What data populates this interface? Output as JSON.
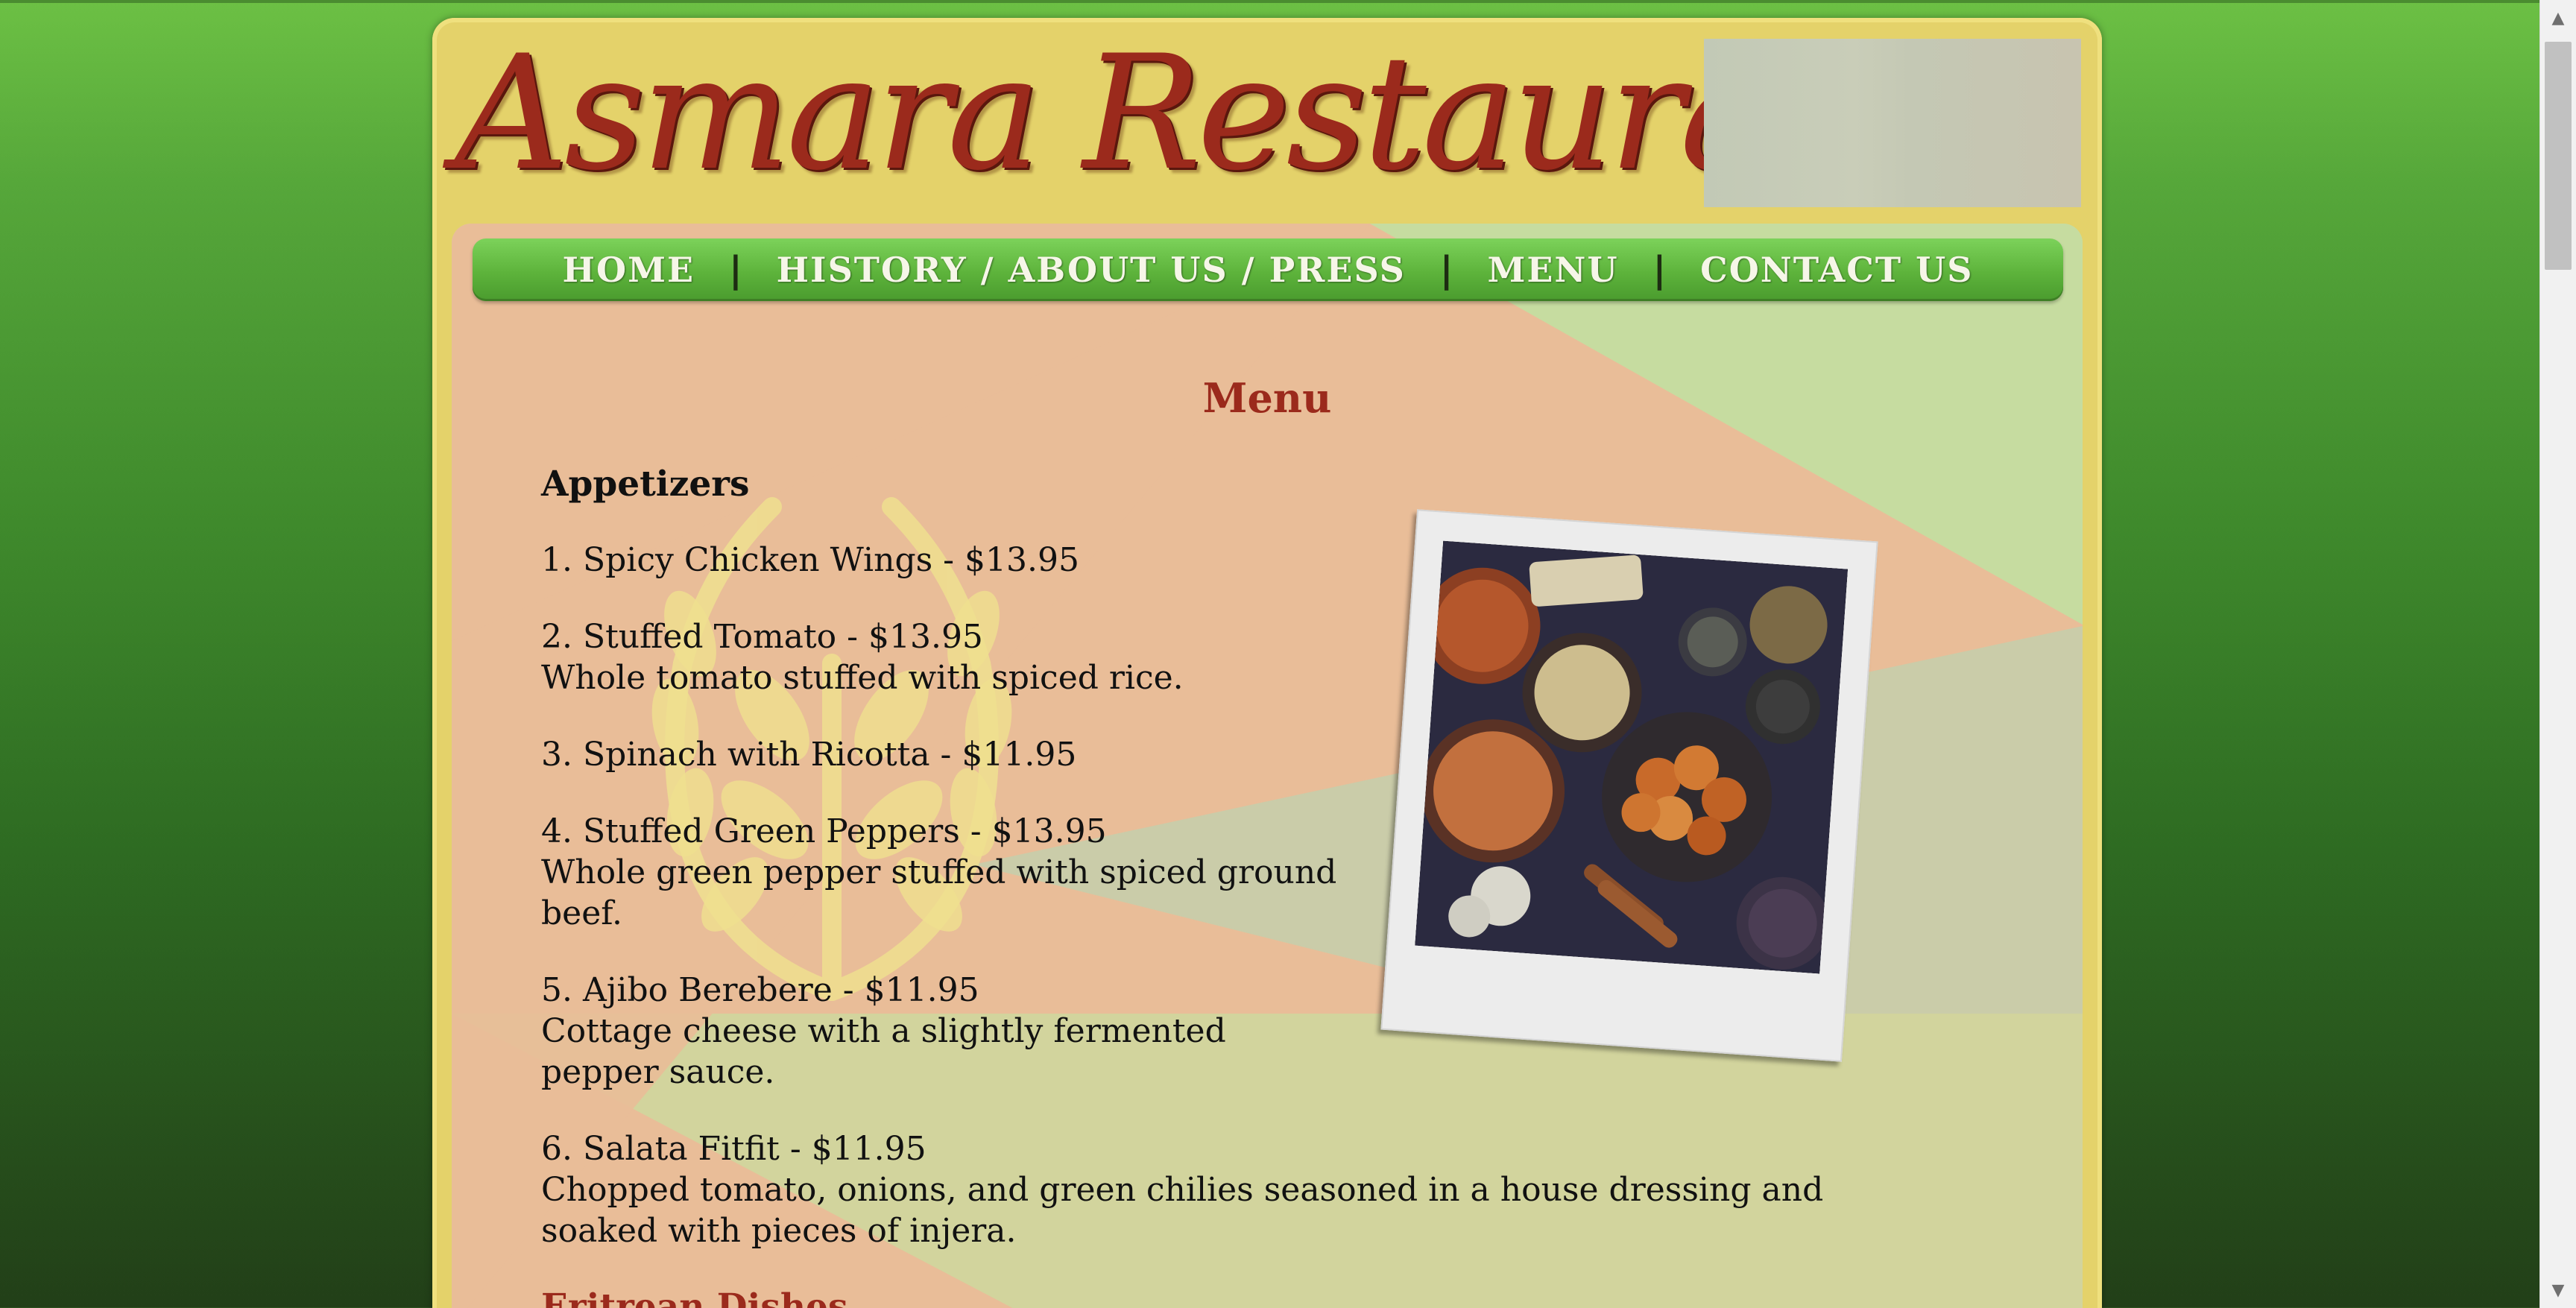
{
  "site": {
    "logo_text": "Asmara Restaurant"
  },
  "nav": {
    "items": [
      "HOME",
      "HISTORY / ABOUT US / PRESS",
      "MENU",
      "CONTACT US"
    ],
    "separator": "|"
  },
  "page": {
    "title": "Menu",
    "section1": "Appetizers",
    "section2": "Eritrean Dishes"
  },
  "appetizers": [
    {
      "title": "1. Spicy Chicken Wings - $13.95",
      "desc": ""
    },
    {
      "title": "2. Stuffed Tomato - $13.95",
      "desc": "Whole tomato stuffed with spiced rice."
    },
    {
      "title": "3. Spinach with Ricotta - $11.95",
      "desc": ""
    },
    {
      "title": "4. Stuffed Green Peppers - $13.95",
      "desc": "Whole green pepper stuffed with spiced ground beef."
    },
    {
      "title": "5. Ajibo Berebere - $11.95",
      "desc": "Cottage cheese with a slightly fermented pepper sauce."
    },
    {
      "title": "6. Salata Fitfit - $11.95",
      "desc": "Chopped tomato, onions, and green chilies seasoned in a house dressing and soaked with pieces of injera."
    }
  ],
  "colors": {
    "background_green": "#3f8a2c",
    "panel_yellow": "#e4d26a",
    "brand_red": "#9b2a1c",
    "nav_green": "#5db33b"
  }
}
